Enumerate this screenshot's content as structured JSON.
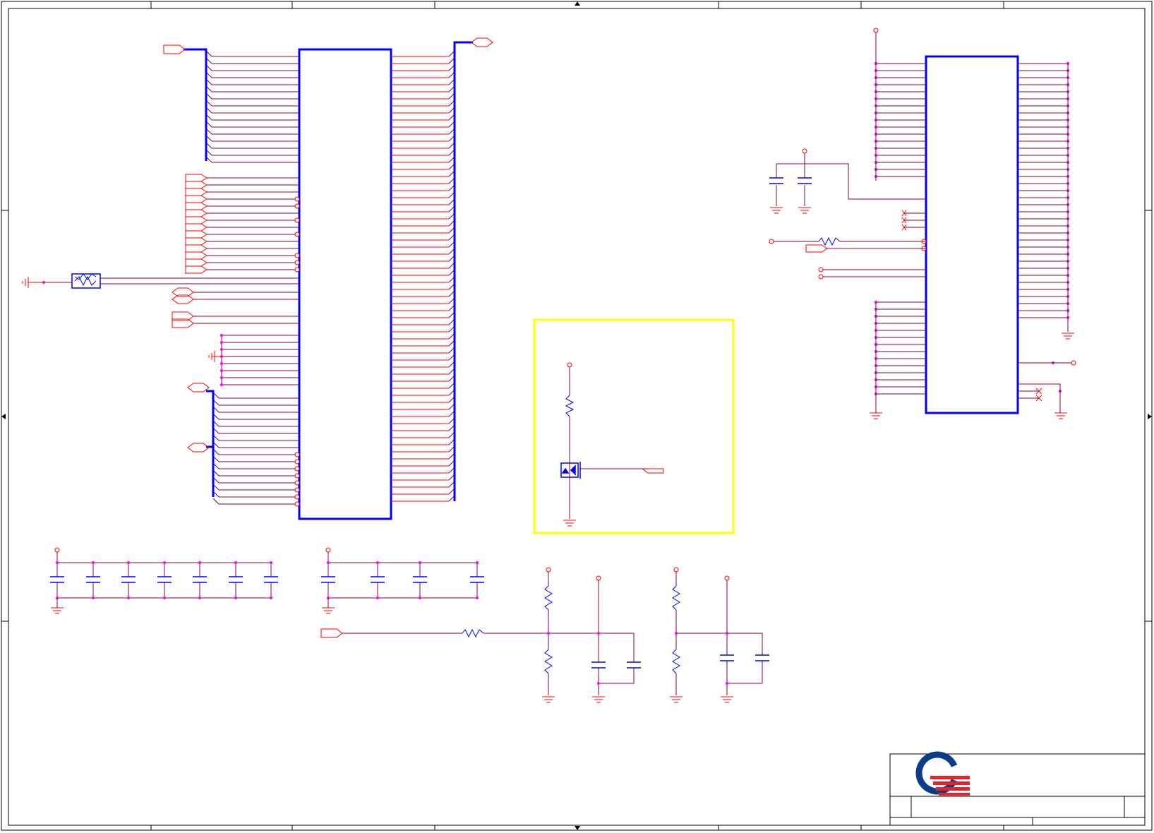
{
  "sheet": {
    "title": "",
    "note": ""
  },
  "colors": {
    "background": "#ffffff",
    "border": "#000000",
    "net_wire": "#800040",
    "pin_wire": "#ff0000",
    "component_body": "#0000ff",
    "junction": "#ff00ff",
    "highlight_box": "#ffff00",
    "logo_blue": "#0b3c8c",
    "logo_red": "#e2232a"
  },
  "components": {
    "main_connector": {
      "name": "main-connector-symbol"
    },
    "right_ic": {
      "name": "right-ic-symbol"
    },
    "mosfet_circuit": {
      "name": "mosfet-level-shift-circuit"
    }
  },
  "icons": {
    "logo": "company-logo-icon",
    "ground": "ground-icon",
    "capacitor": "capacitor-icon",
    "resistor": "resistor-icon",
    "fuse": "fuse-icon",
    "port": "port-connector-icon",
    "mosfet": "mosfet-icon"
  }
}
